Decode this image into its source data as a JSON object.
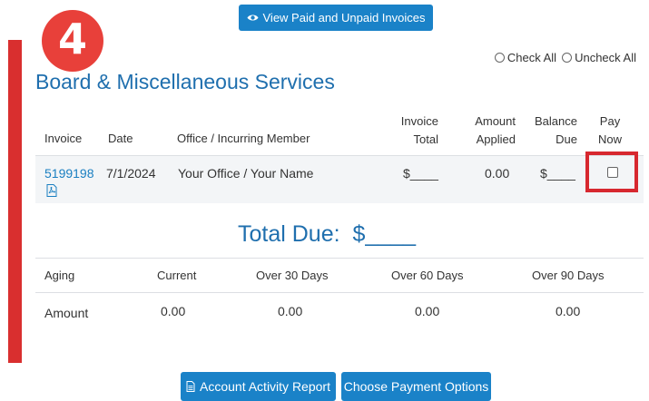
{
  "toolbar": {
    "view_label": "View Paid and Unpaid Invoices",
    "view_icon": "eye-icon"
  },
  "step_number": "4",
  "check_controls": {
    "check_all": "Check All",
    "uncheck_all": "Uncheck All"
  },
  "section_title": "Board & Miscellaneous Services",
  "table": {
    "headers": {
      "invoice": "Invoice",
      "date": "Date",
      "office": "Office / Incurring Member",
      "invoice_total_1": "Invoice",
      "invoice_total_2": "Total",
      "amount_applied_1": "Amount",
      "amount_applied_2": "Applied",
      "balance_due_1": "Balance",
      "balance_due_2": "Due",
      "pay_now_1": "Pay",
      "pay_now_2": "Now"
    },
    "rows": [
      {
        "invoice": "5199198",
        "date": "7/1/2024",
        "office": "Your Office / Your Name",
        "invoice_total": "$____",
        "amount_applied": "0.00",
        "balance_due": "$____",
        "pay_now": false
      }
    ]
  },
  "total_due": {
    "label": "Total Due:",
    "value": "$____"
  },
  "aging": {
    "headers": {
      "aging": "Aging",
      "current": "Current",
      "over30": "Over 30 Days",
      "over60": "Over 60 Days",
      "over90": "Over 90 Days"
    },
    "amount_label": "Amount",
    "values": {
      "current": "0.00",
      "over30": "0.00",
      "over60": "0.00",
      "over90": "0.00"
    }
  },
  "footer": {
    "activity_label": "Account Activity Report",
    "activity_icon": "document-icon",
    "payment_label": "Choose Payment Options"
  },
  "colors": {
    "accent_blue": "#1a82c8",
    "title_blue": "#1f6fae",
    "highlight_red": "#d92f2f"
  }
}
